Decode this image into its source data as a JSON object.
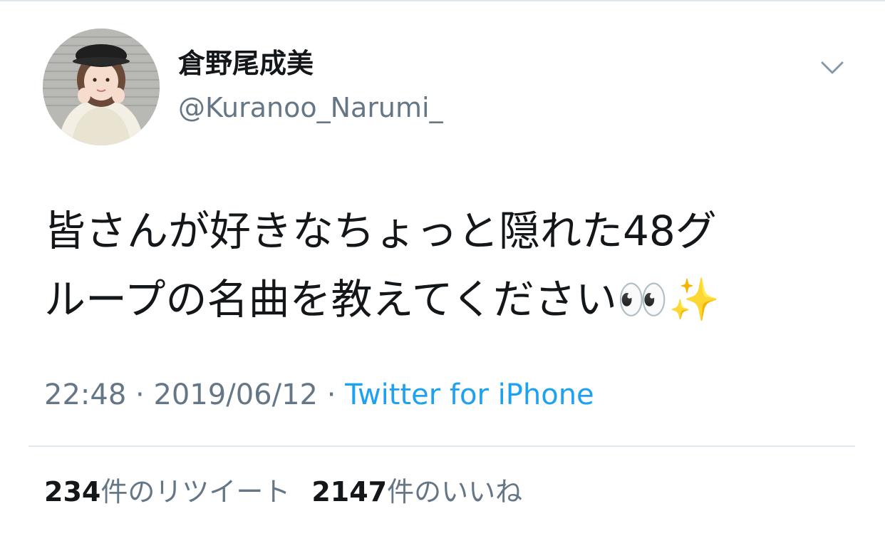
{
  "tweet": {
    "author": {
      "display_name": "倉野尾成美",
      "handle": "@Kuranoo_Narumi_"
    },
    "text_line1": "皆さんが好きなちょっと隠れた48グ",
    "text_line2": "ループの名曲を教えてください👀✨",
    "time": "22:48",
    "separator": " · ",
    "date": "2019/06/12",
    "source": "Twitter for iPhone",
    "retweets": {
      "count": "234",
      "label": "件のリツイート"
    },
    "likes": {
      "count": "2147",
      "label": "件のいいね"
    }
  },
  "icons": {
    "menu": "chevron-down-icon",
    "avatar": "avatar"
  },
  "colors": {
    "text": "#14171a",
    "secondary": "#657786",
    "link": "#1da1f2",
    "divider": "#e1e8ed"
  }
}
